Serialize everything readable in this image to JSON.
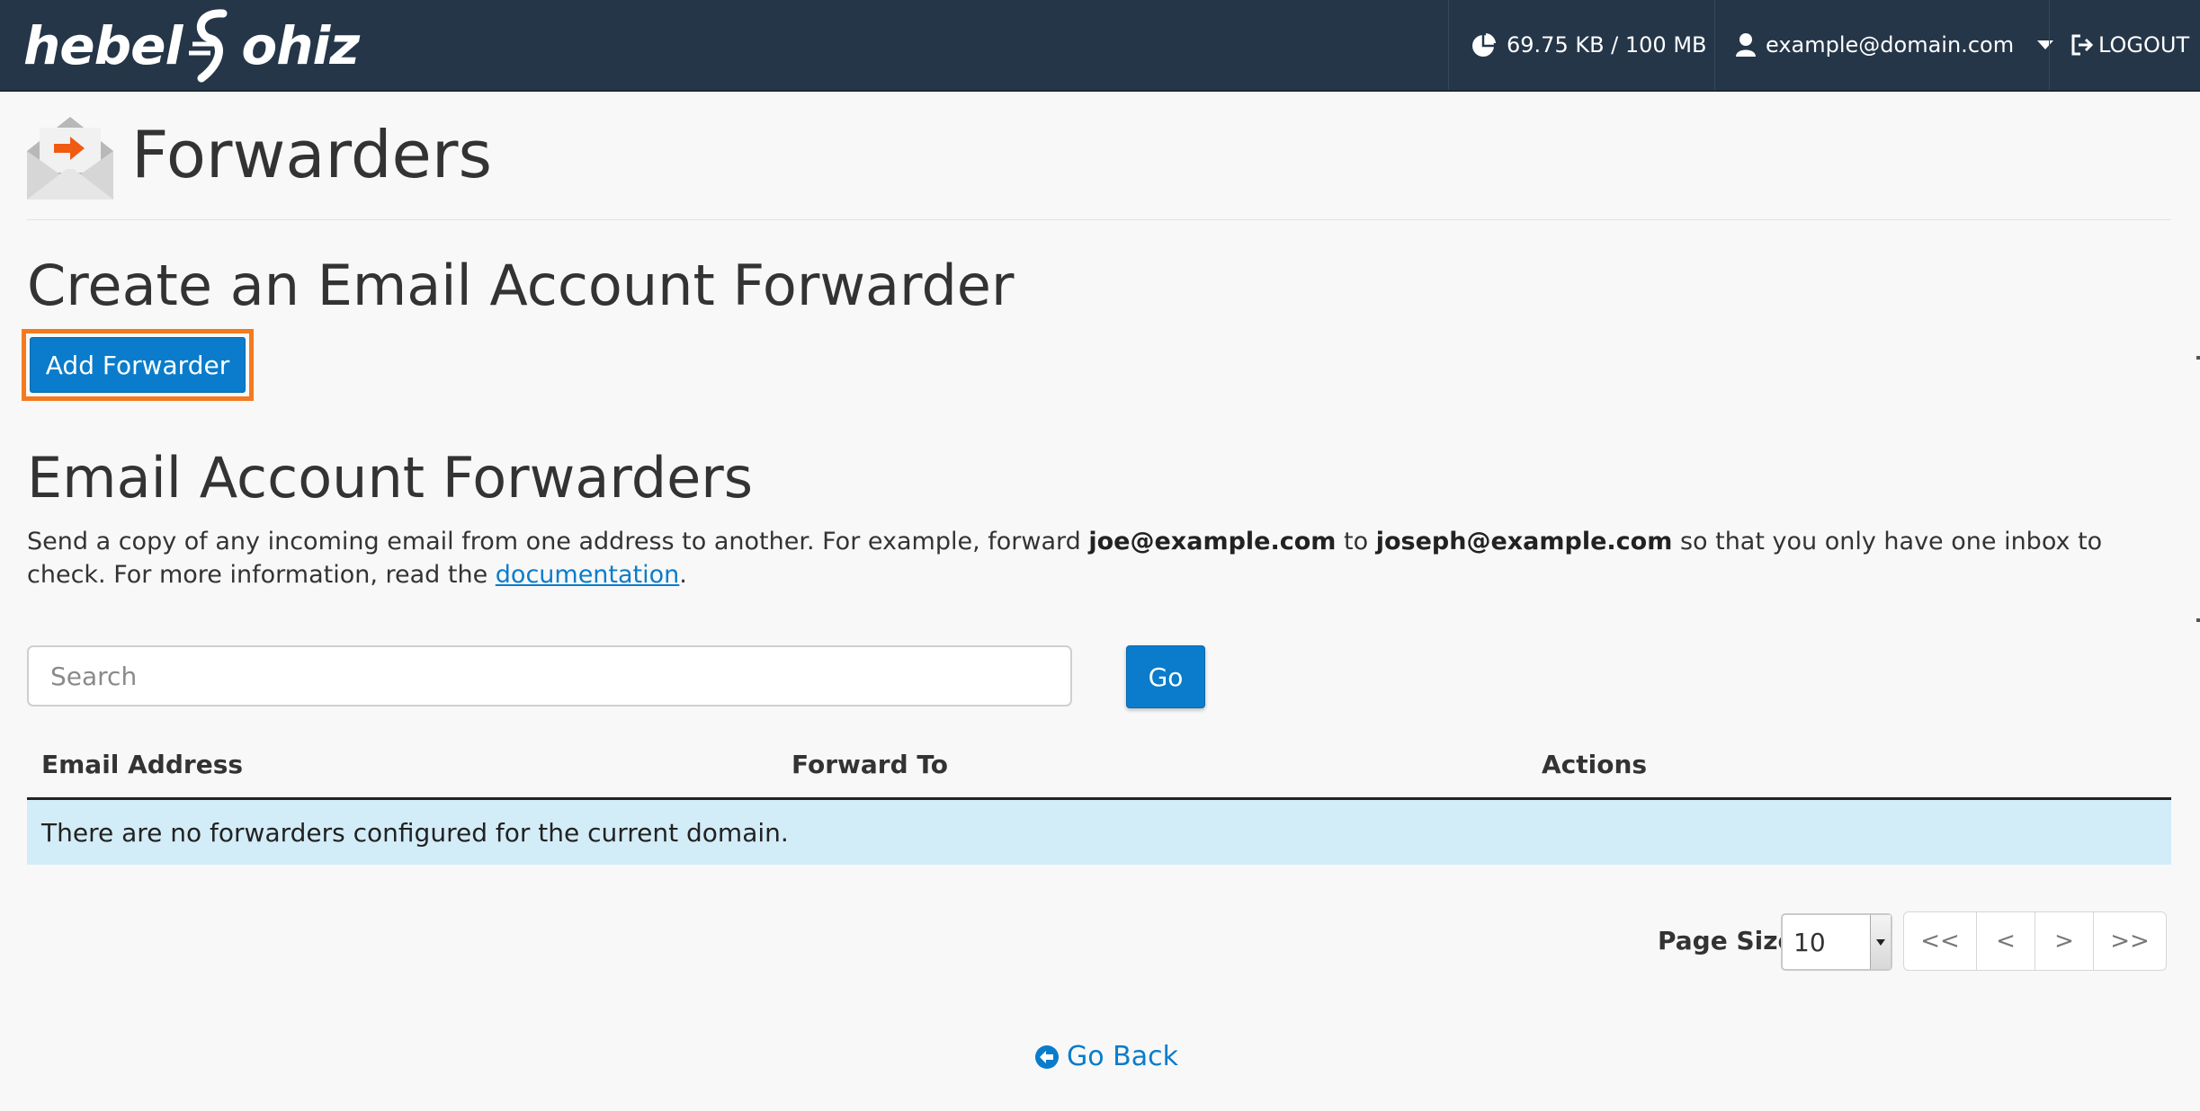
{
  "header": {
    "logo_left": "hebel",
    "logo_right": "ohiz",
    "usage": "69.75 KB / 100 MB",
    "user": "example@domain.com",
    "logout": "LOGOUT"
  },
  "page": {
    "title": "Forwarders"
  },
  "create_section": {
    "heading": "Create an Email Account Forwarder",
    "add_button": "Add Forwarder"
  },
  "list_section": {
    "heading": "Email Account Forwarders",
    "desc_1": "Send a copy of any incoming email from one address to another. For example, forward ",
    "example_from": "joe@example.com",
    "desc_2": " to ",
    "example_to": "joseph@example.com",
    "desc_3": " so that you only have one inbox to check. For more information, read the ",
    "doc_link": "documentation",
    "desc_4": "."
  },
  "search": {
    "placeholder": "Search",
    "value": "",
    "go_label": "Go"
  },
  "table": {
    "columns": [
      "Email Address",
      "Forward To",
      "Actions"
    ],
    "empty_message": "There are no forwarders configured for the current domain."
  },
  "pagination": {
    "page_size_label": "Page Size",
    "page_size_value": "10",
    "first": "<<",
    "prev": "<",
    "next": ">",
    "last": ">>"
  },
  "footer": {
    "go_back": "Go Back"
  },
  "colors": {
    "topbar": "#253649",
    "primary": "#0a7ccb",
    "highlight_border": "#f47a1f",
    "empty_row": "#d3edf8",
    "background": "#f8f8f8"
  },
  "icons": {
    "usage": "pie-chart-icon",
    "user": "user-icon",
    "logout": "logout-icon",
    "page": "email-forward-icon",
    "go_back": "arrow-circle-left-icon"
  }
}
